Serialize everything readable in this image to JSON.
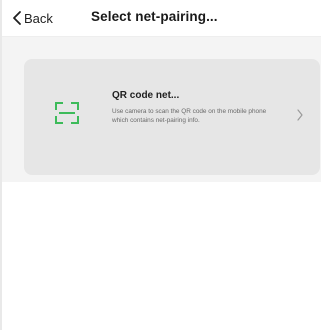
{
  "nav": {
    "back_label": "Back",
    "title": "Select net-pairing..."
  },
  "option": {
    "title": "QR code net...",
    "description": "Use camera to scan the QR code on the mobile phone which contains net-pairing info.",
    "icon": "qr-scan-icon"
  },
  "colors": {
    "accent_green": "#3dbb5a",
    "card_background": "#e6e6e6",
    "content_background": "#f4f4f4"
  }
}
